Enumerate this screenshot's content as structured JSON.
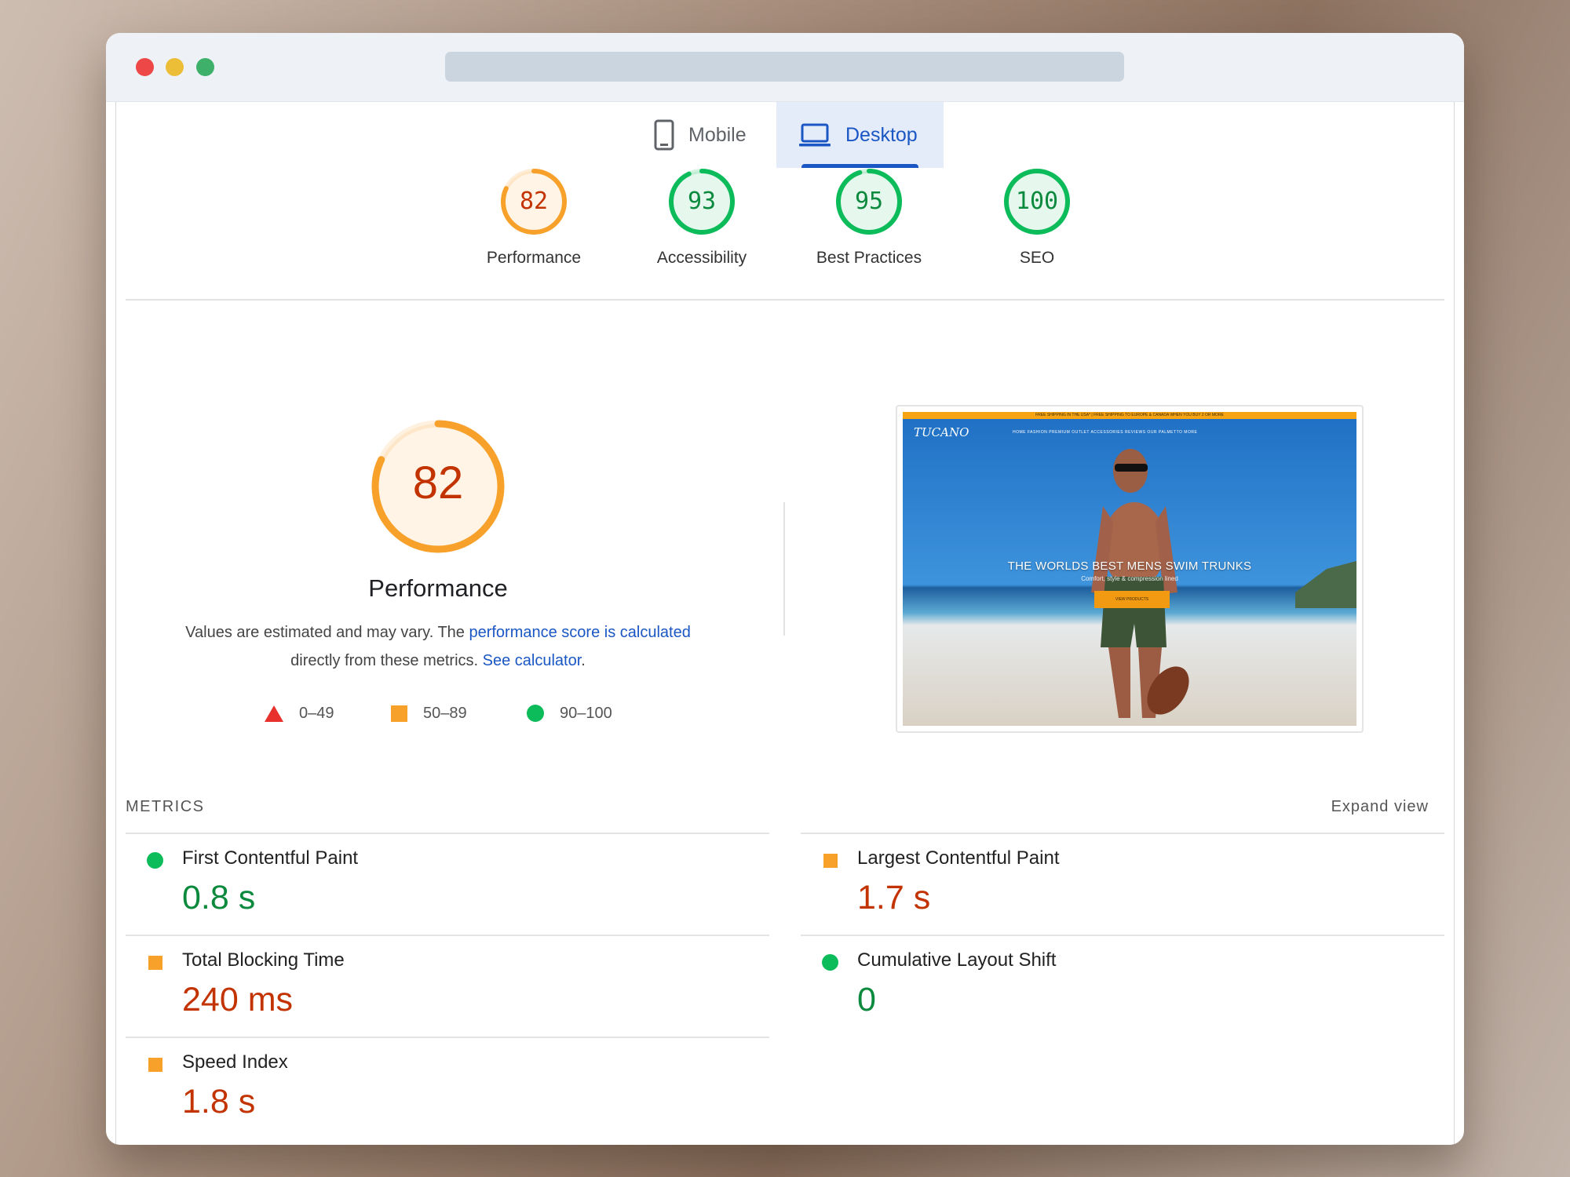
{
  "tabs": {
    "mobile_label": "Mobile",
    "desktop_label": "Desktop",
    "active": "Desktop"
  },
  "categories": [
    {
      "label": "Performance",
      "score": "82",
      "value": 82,
      "status": "average",
      "color": "#f7a12b",
      "text_color": "#c33300"
    },
    {
      "label": "Accessibility",
      "score": "93",
      "value": 93,
      "status": "pass",
      "color": "#0cbb59",
      "text_color": "#0b8a3e"
    },
    {
      "label": "Best Practices",
      "score": "95",
      "value": 95,
      "status": "pass",
      "color": "#0cbb59",
      "text_color": "#0b8a3e"
    },
    {
      "label": "SEO",
      "score": "100",
      "value": 100,
      "status": "pass",
      "color": "#0cbb59",
      "text_color": "#0b8a3e"
    }
  ],
  "performance": {
    "score": "82",
    "value": 82,
    "title": "Performance",
    "desc_part1": "Values are estimated and may vary. The ",
    "desc_link1": "performance score is calculated",
    "desc_part2": " directly from these metrics. ",
    "desc_link2": "See calculator",
    "desc_part3": "."
  },
  "legend": {
    "fail": "0–49",
    "average": "50–89",
    "pass": "90–100"
  },
  "screenshot": {
    "banner": "FREE SHIPPING IN THE USA* | FREE SHIPPING TO EUROPE & CANADA WHEN YOU BUY 2 OR MORE",
    "logo": "TUCANO",
    "nav_links": "HOME    FASHION    PREMIUM OUTLET    ACCESSORIES    REVIEWS    OUR PALMETTO    MORE",
    "headline": "THE WORLDS BEST MENS SWIM TRUNKS",
    "subline": "Comfort, style & compression lined",
    "button": "VIEW PRODUCTS"
  },
  "metrics": {
    "heading": "METRICS",
    "expand_label": "Expand view",
    "items": [
      {
        "name": "First Contentful Paint",
        "value": "0.8 s",
        "status": "pass"
      },
      {
        "name": "Largest Contentful Paint",
        "value": "1.7 s",
        "status": "average"
      },
      {
        "name": "Total Blocking Time",
        "value": "240 ms",
        "status": "average"
      },
      {
        "name": "Cumulative Layout Shift",
        "value": "0",
        "status": "pass"
      },
      {
        "name": "Speed Index",
        "value": "1.8 s",
        "status": "average"
      }
    ]
  },
  "colors": {
    "pass": "#0cbb59",
    "average": "#f7a12b",
    "fail": "#e8312c",
    "link": "#1a56c4"
  }
}
